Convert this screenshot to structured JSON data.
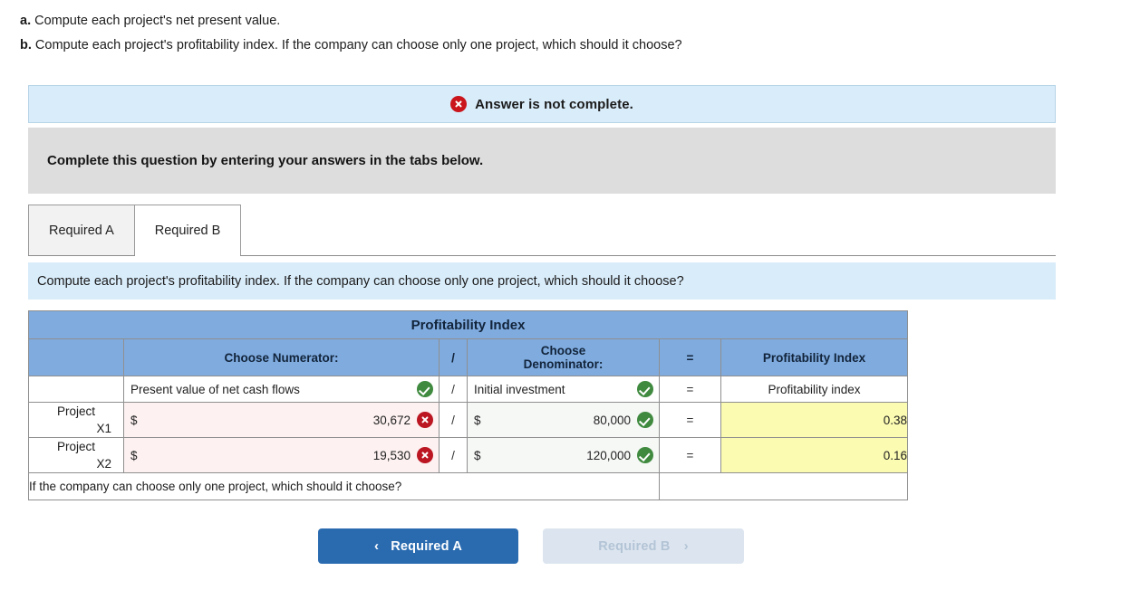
{
  "stem": {
    "line_a_label": "a.",
    "line_a": " Compute each project's net present value.",
    "line_b_label": "b.",
    "line_b": " Compute each project's profitability index. If the company can choose only one project, which should it choose?"
  },
  "alert": {
    "icon": "x-circle-red-icon",
    "text": "Answer is not complete."
  },
  "instruction": {
    "text": "Complete this question by entering your answers in the tabs below."
  },
  "tabs": [
    {
      "label": "Required A",
      "active": false
    },
    {
      "label": "Required B",
      "active": true
    }
  ],
  "prompt": {
    "text": "Compute each project's profitability index. If the company can choose only one project, which should it choose?"
  },
  "table": {
    "title": "Profitability Index",
    "headers": {
      "row_label": "",
      "numerator": "Choose Numerator:",
      "slash": "/",
      "denominator_line1": "Choose",
      "denominator_line2": "Denominator:",
      "equals": "=",
      "result": "Profitability Index"
    },
    "label_row": {
      "row_label": "",
      "numerator": "Present value of net cash flows",
      "numerator_mark": "check-green",
      "slash": "/",
      "denominator": "Initial investment",
      "denominator_mark": "check-green",
      "equals": "=",
      "result": "Profitability index"
    },
    "rows": [
      {
        "label_line1": "Project",
        "label_line2": "X1",
        "num_currency": "$",
        "num_value": "30,672",
        "num_mark": "x-dark",
        "slash": "/",
        "den_currency": "$",
        "den_value": "80,000",
        "den_mark": "check-green",
        "equals": "=",
        "result": "0.38"
      },
      {
        "label_line1": "Project",
        "label_line2": "X2",
        "num_currency": "$",
        "num_value": "19,530",
        "num_mark": "x-dark",
        "slash": "/",
        "den_currency": "$",
        "den_value": "120,000",
        "den_mark": "check-green",
        "equals": "=",
        "result": "0.16"
      }
    ],
    "footer": {
      "question": "If the company can choose only one project, which should it choose?",
      "answer": ""
    }
  },
  "nav": {
    "prev_label": "Required A",
    "prev_chevron": "‹",
    "next_label": "Required B",
    "next_chevron": "›"
  },
  "colors": {
    "header_blue": "#7fabdf",
    "banner_blue": "#d9ecfa",
    "instruction_gray": "#dddddd",
    "wrong_pink": "#fdf1f1",
    "result_yellow": "#fbfbb2",
    "check_green": "#3f8a3f",
    "error_red": "#bb1622",
    "primary_button": "#2a6bb0",
    "disabled_button": "#dce5ef"
  }
}
